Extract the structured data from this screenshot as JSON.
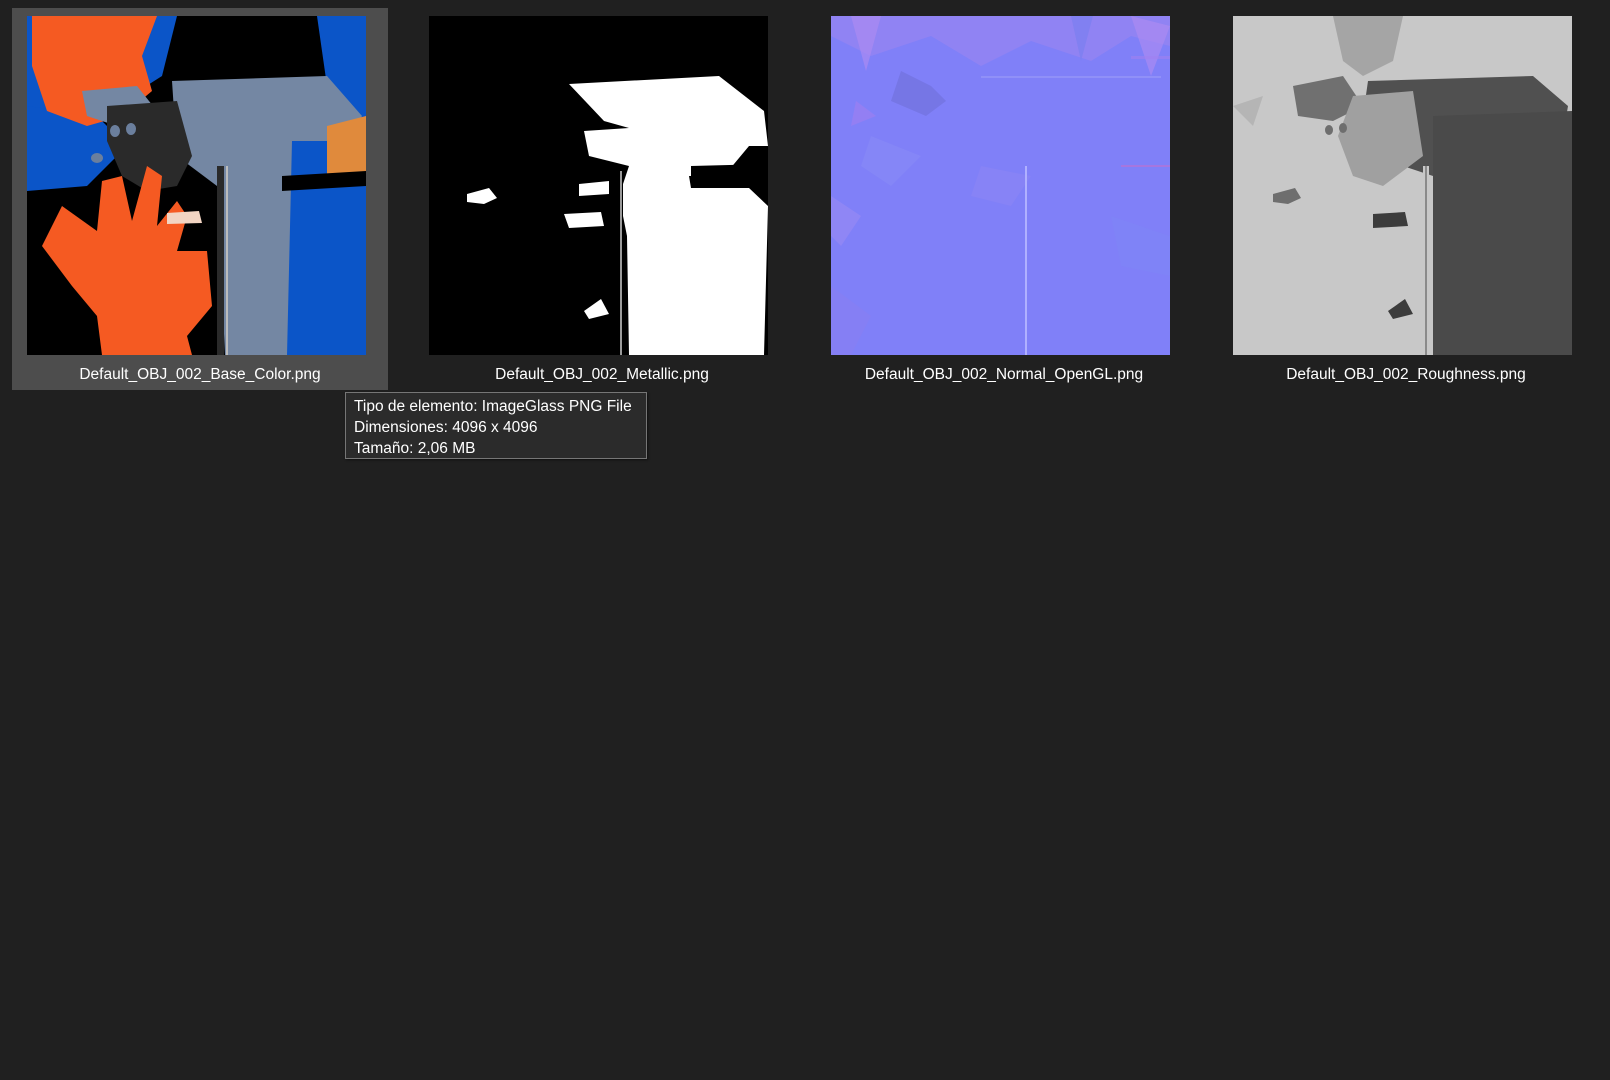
{
  "files": [
    {
      "name": "Default_OBJ_002_Base_Color.png",
      "selected": true
    },
    {
      "name": "Default_OBJ_002_Metallic.png",
      "selected": false
    },
    {
      "name": "Default_OBJ_002_Normal_OpenGL.png",
      "selected": false
    },
    {
      "name": "Default_OBJ_002_Roughness.png",
      "selected": false
    }
  ],
  "tooltip": {
    "line1": "Tipo de elemento: ImageGlass PNG File",
    "line2": "Dimensiones: 4096 x 4096",
    "line3": "Tamaño: 2,06 MB"
  },
  "colors": {
    "background": "#202020",
    "selection": "#4d4d4d",
    "normal_map": "#8080f8",
    "base_orange": "#f55a22",
    "base_blue": "#0b55c8",
    "base_slate": "#7487a3"
  }
}
